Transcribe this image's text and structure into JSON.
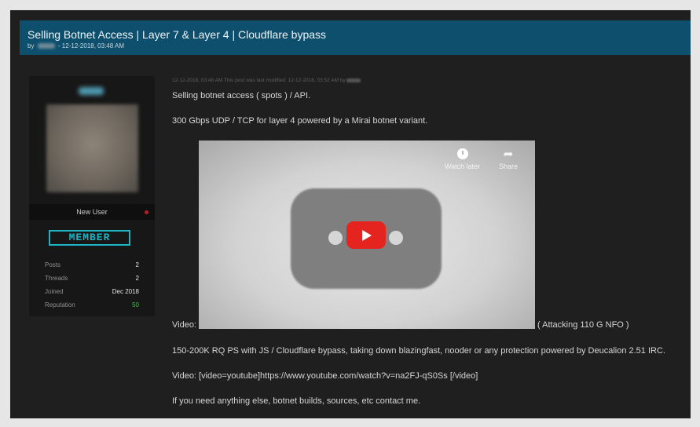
{
  "thread": {
    "title": "Selling Botnet Access | Layer 7 & Layer 4 | Cloudflare bypass",
    "by_prefix": "by",
    "date": "- 12-12-2018, 03:48 AM"
  },
  "user": {
    "rank_label": "New User",
    "badge": "MEMBER",
    "stats": [
      {
        "label": "Posts",
        "value": "2"
      },
      {
        "label": "Threads",
        "value": "2"
      },
      {
        "label": "Joined",
        "value": "Dec 2018"
      },
      {
        "label": "Reputation",
        "value": "50"
      }
    ]
  },
  "post": {
    "meta": "12-12-2018, 03:48 AM  This post was last modified: 12-12-2018, 03:52 AM by",
    "lines": [
      "Selling botnet access ( spots ) / API.",
      "300 Gbps UDP / TCP for layer 4 powered by a Mirai botnet variant.",
      "Video:",
      "( Attacking 110 G NFO )",
      "150-200K RQ PS with JS / Cloudflare bypass, taking down blazingfast, nooder or any protection powered by Deucalion 2.51 IRC.",
      "Video: [video=youtube]https://www.youtube.com/watch?v=na2FJ-qS0Ss [/video]",
      "If you need anything else, botnet builds, sources, etc contact me."
    ],
    "video": {
      "watch_later": "Watch later",
      "share": "Share",
      "icons": [
        "clock-icon",
        "share-icon",
        "play-icon"
      ]
    }
  }
}
